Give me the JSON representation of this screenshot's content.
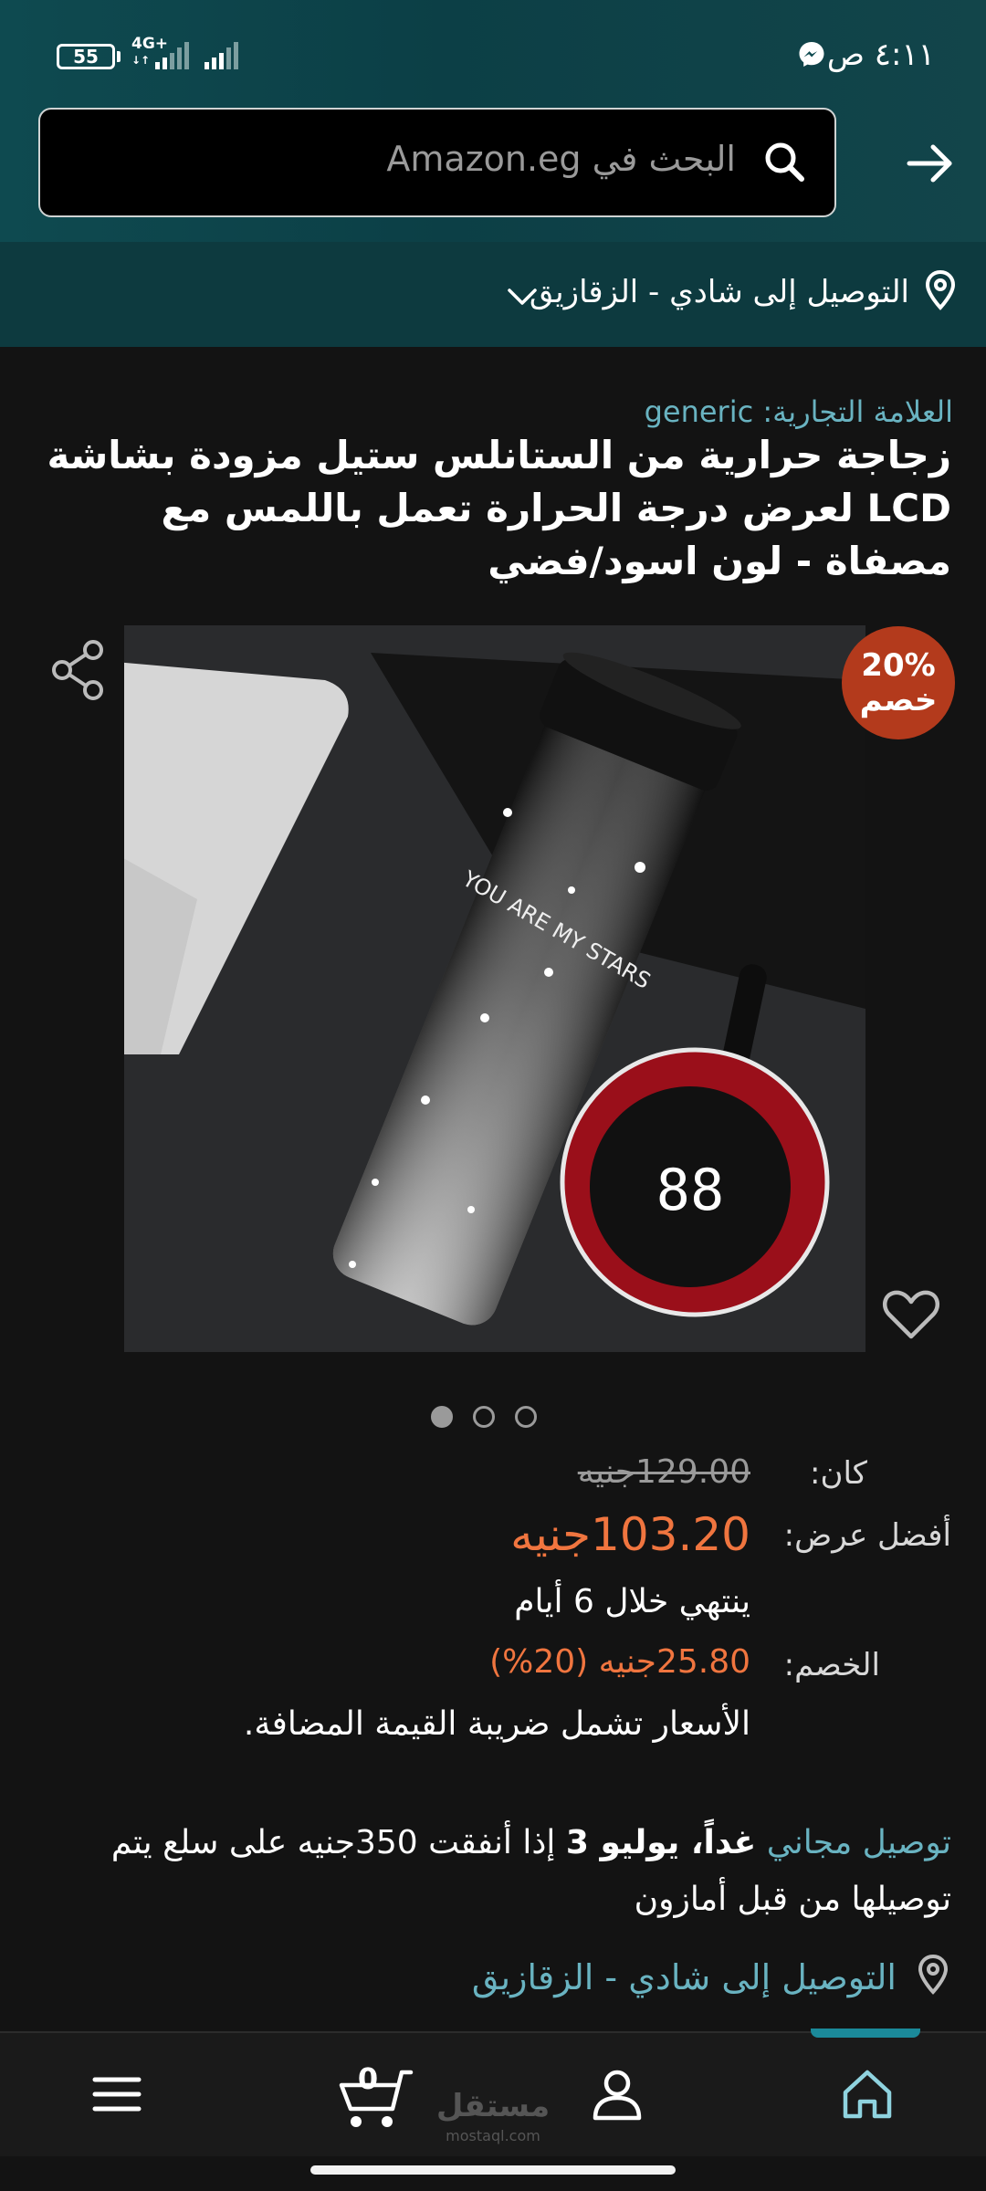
{
  "status_bar": {
    "time": "٤:١١ ص",
    "battery": "55",
    "network": "4G+"
  },
  "search": {
    "placeholder": "البحث في Amazon.eg"
  },
  "delivery": {
    "label": "التوصيل إلى شادي - الزقازيق"
  },
  "product": {
    "brand": "العلامة التجارية: generic",
    "title": "زجاجة حرارية من الستانلس ستيل مزودة بشاشة LCD لعرض درجة الحرارة تعمل باللمس مع مصفاة - لون اسود/فضي",
    "badge_percent": "20%",
    "badge_word": "خصم",
    "image_text": "YOU ARE MY STARS",
    "display_reading": "88",
    "carousel_count": 3,
    "carousel_active": 0
  },
  "pricing": {
    "was_label": "كان:",
    "was_value": "129.00جنيه",
    "best_label": "أفضل عرض:",
    "best_value": "103.20جنيه",
    "ends_in": "ينتهي خلال 6 أيام",
    "saving_label": "الخصم:",
    "saving_value": "25.80جنيه (20%)",
    "vat_note": "الأسعار تشمل ضريبة القيمة المضافة."
  },
  "shipping": {
    "free_link": "توصيل مجاني",
    "date_bold": "غداً، يوليو 3",
    "condition": "إذا أنفقت 350جنيه على سلع يتم توصيلها من قبل أمازون",
    "deliver_to": "التوصيل إلى شادي - الزقازيق"
  },
  "bottom_nav": {
    "cart_count": "0",
    "watermark": "مستقل",
    "watermark_sub": "mostaql.com"
  },
  "colors": {
    "accent_link": "#69b3c1",
    "price_orange": "#f0753f",
    "badge_red": "#b33a1c",
    "header_teal": "#0e4a50"
  },
  "icons": [
    "messenger-icon",
    "search-icon",
    "forward-arrow-icon",
    "location-pin-icon",
    "chevron-down-icon",
    "share-icon",
    "heart-icon",
    "home-icon",
    "account-icon",
    "cart-icon",
    "menu-icon"
  ]
}
